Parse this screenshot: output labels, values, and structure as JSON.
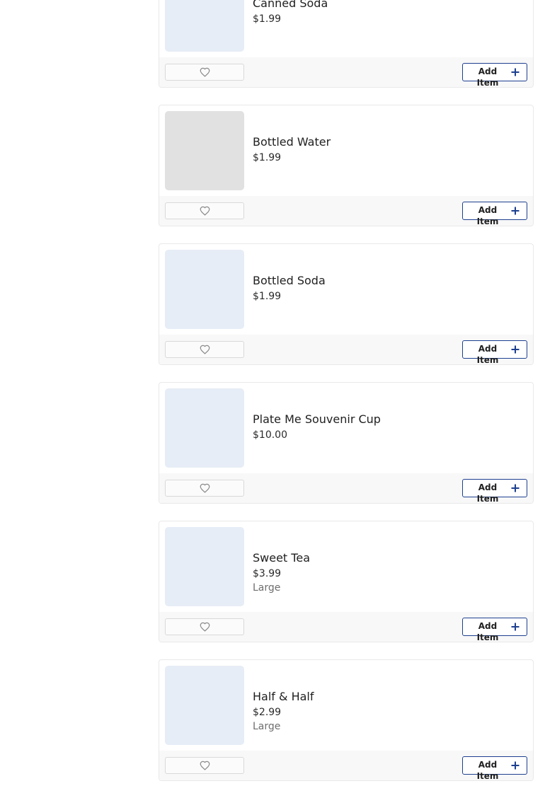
{
  "items": [
    {
      "name": "Canned Soda",
      "price": "$1.99",
      "variant": "",
      "thumb": "blue",
      "add_label": "Add Item"
    },
    {
      "name": "Bottled Water",
      "price": "$1.99",
      "variant": "",
      "thumb": "gray",
      "add_label": "Add Item"
    },
    {
      "name": "Bottled Soda",
      "price": "$1.99",
      "variant": "",
      "thumb": "blue",
      "add_label": "Add Item"
    },
    {
      "name": "Plate Me Souvenir Cup",
      "price": "$10.00",
      "variant": "",
      "thumb": "blue",
      "add_label": "Add Item"
    },
    {
      "name": "Sweet Tea",
      "price": "$3.99",
      "variant": "Large",
      "thumb": "blue",
      "add_label": "Add Item"
    },
    {
      "name": "Half & Half",
      "price": "$2.99",
      "variant": "Large",
      "thumb": "blue",
      "add_label": "Add Item"
    }
  ],
  "icons": {
    "favorite": "heart-outline-icon",
    "add": "plus-icon"
  },
  "colors": {
    "accent_border": "#1d3f8f",
    "thumb_placeholder": "#e6edf6",
    "thumb_placeholder_gray": "#e1e1e1",
    "footer_bg": "#f8f8f8"
  }
}
